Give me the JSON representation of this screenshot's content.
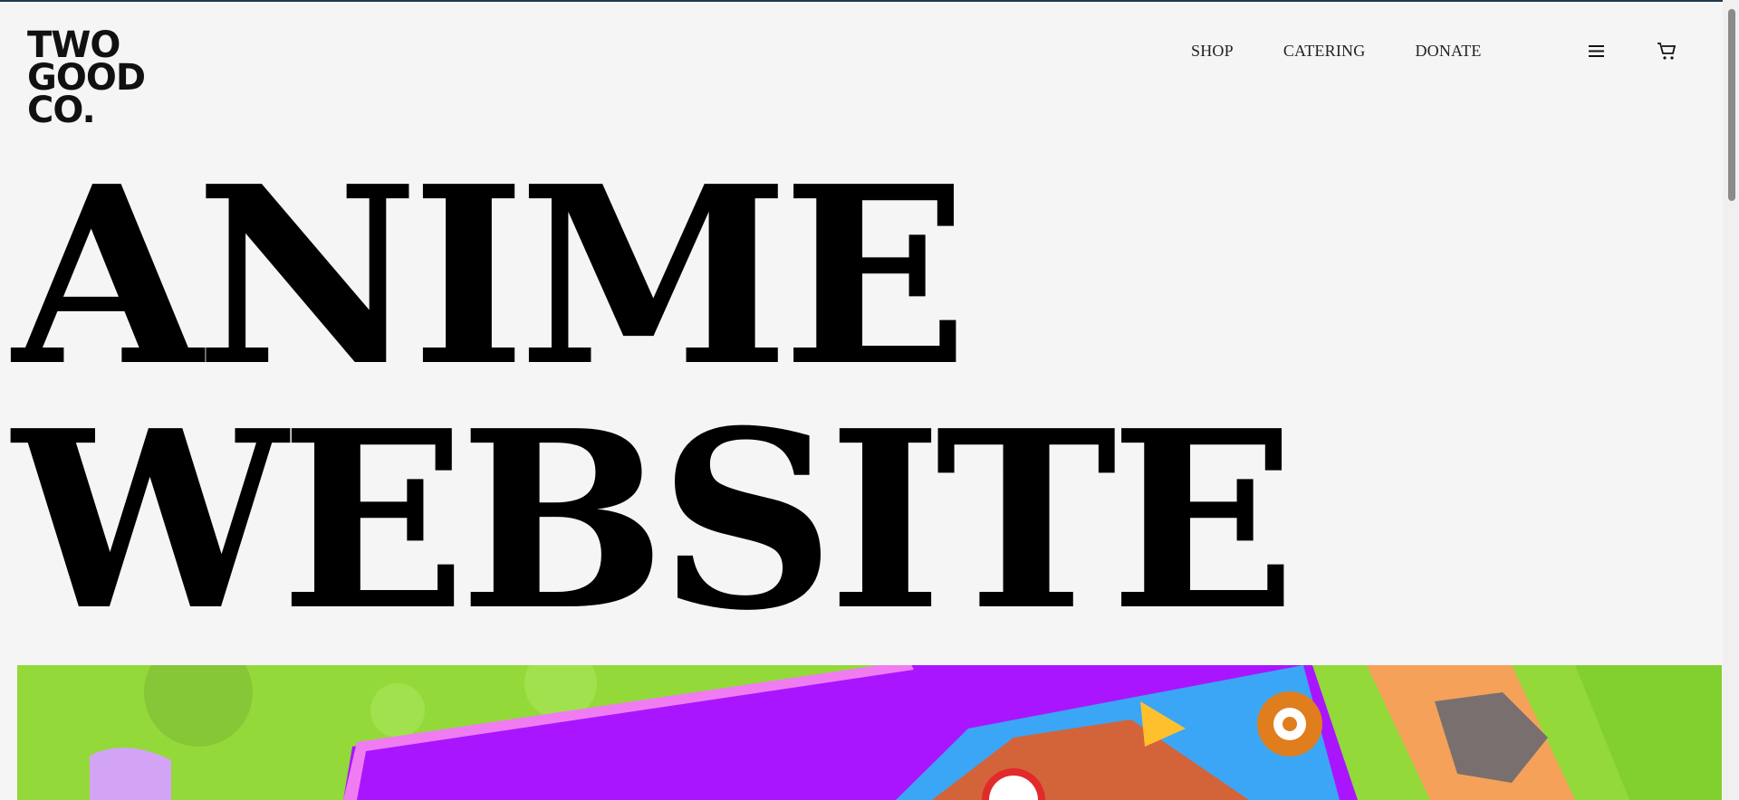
{
  "brand": {
    "logo_lines": [
      "TWO",
      "GOOD",
      "CO."
    ]
  },
  "nav": {
    "items": [
      {
        "label": "SHOP"
      },
      {
        "label": "CATERING"
      },
      {
        "label": "DONATE"
      }
    ],
    "menu_icon": "hamburger-menu-icon",
    "cart_icon": "cart-icon"
  },
  "hero": {
    "headline_lines": [
      "ANIME",
      "WEBSITE"
    ],
    "image": "colorful cartoon game scene with purple banner, house roof and gear"
  },
  "colors": {
    "background": "#f5f5f5",
    "text": "#000000",
    "accent_purple": "#a915ff",
    "accent_green": "#8fd63a"
  }
}
